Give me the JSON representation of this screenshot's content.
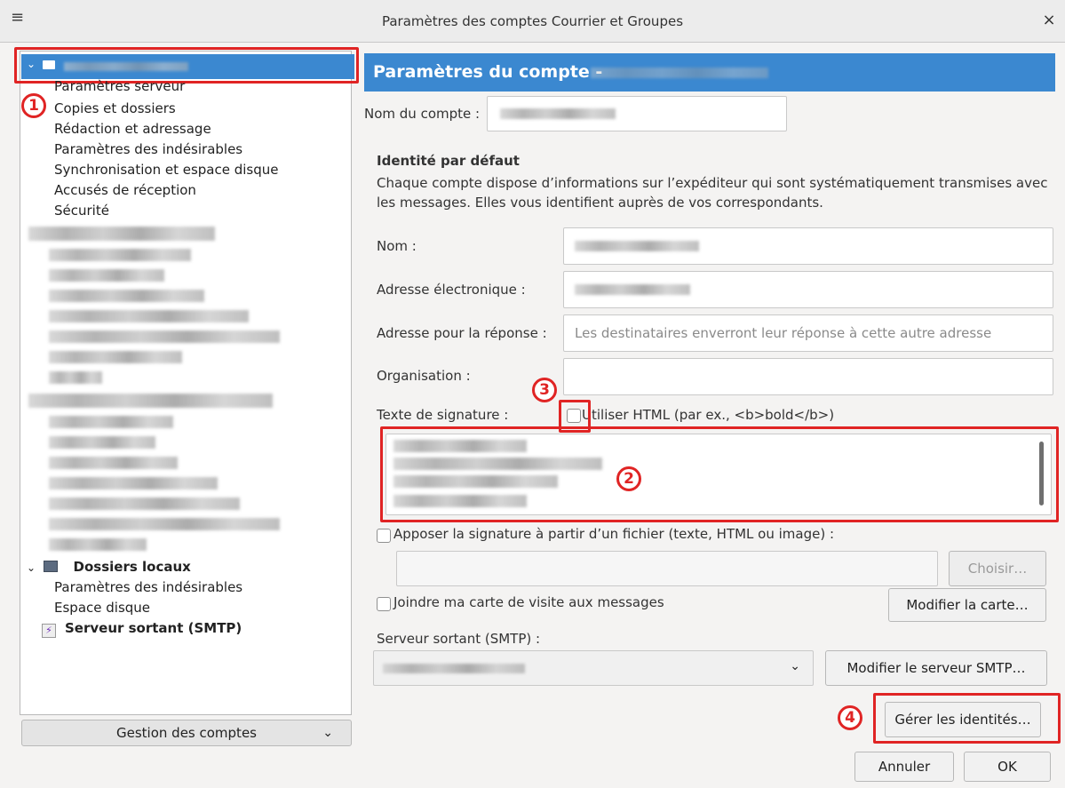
{
  "window": {
    "title": "Paramètres des comptes Courrier et Groupes"
  },
  "tree": {
    "account_sub_items": [
      "Paramètres serveur",
      "Copies et dossiers",
      "Rédaction et adressage",
      "Paramètres des indésirables",
      "Synchronisation et espace disque",
      "Accusés de réception",
      "Sécurité"
    ],
    "local_folders": {
      "label": "Dossiers locaux",
      "items": [
        "Paramètres des indésirables",
        "Espace disque"
      ]
    },
    "smtp": "Serveur sortant (SMTP)"
  },
  "gestion_button": "Gestion des comptes",
  "account": {
    "header_title": "Paramètres du compte -",
    "name_label": "Nom du compte :",
    "identity_heading": "Identité par défaut",
    "identity_desc_1": "Chaque compte dispose d’informations sur l’expéditeur qui sont systématiquement transmises avec",
    "identity_desc_2": "les messages. Elles vous identifient auprès de vos correspondants.",
    "fields": {
      "nom": "Nom :",
      "email": "Adresse électronique :",
      "reply": "Adresse pour la réponse :",
      "reply_placeholder": "Les destinataires enverront leur réponse à cette autre adresse",
      "org": "Organisation :",
      "signature": "Texte de signature :"
    },
    "html_checkbox": "Utiliser HTML (par ex., <b>bold</b>)",
    "sig_file_checkbox": "Apposer la signature à partir d’un fichier (texte, HTML ou image) :",
    "choose_button": "Choisir…",
    "vcard_checkbox": "Joindre ma carte de visite aux messages",
    "edit_card_button": "Modifier la carte…",
    "smtp_label": "Serveur sortant (SMTP) :",
    "edit_smtp_button": "Modifier le serveur SMTP…",
    "identities_button": "Gérer les identités…"
  },
  "footer": {
    "cancel": "Annuler",
    "ok": "OK"
  },
  "annotations": [
    "1",
    "2",
    "3",
    "4"
  ]
}
